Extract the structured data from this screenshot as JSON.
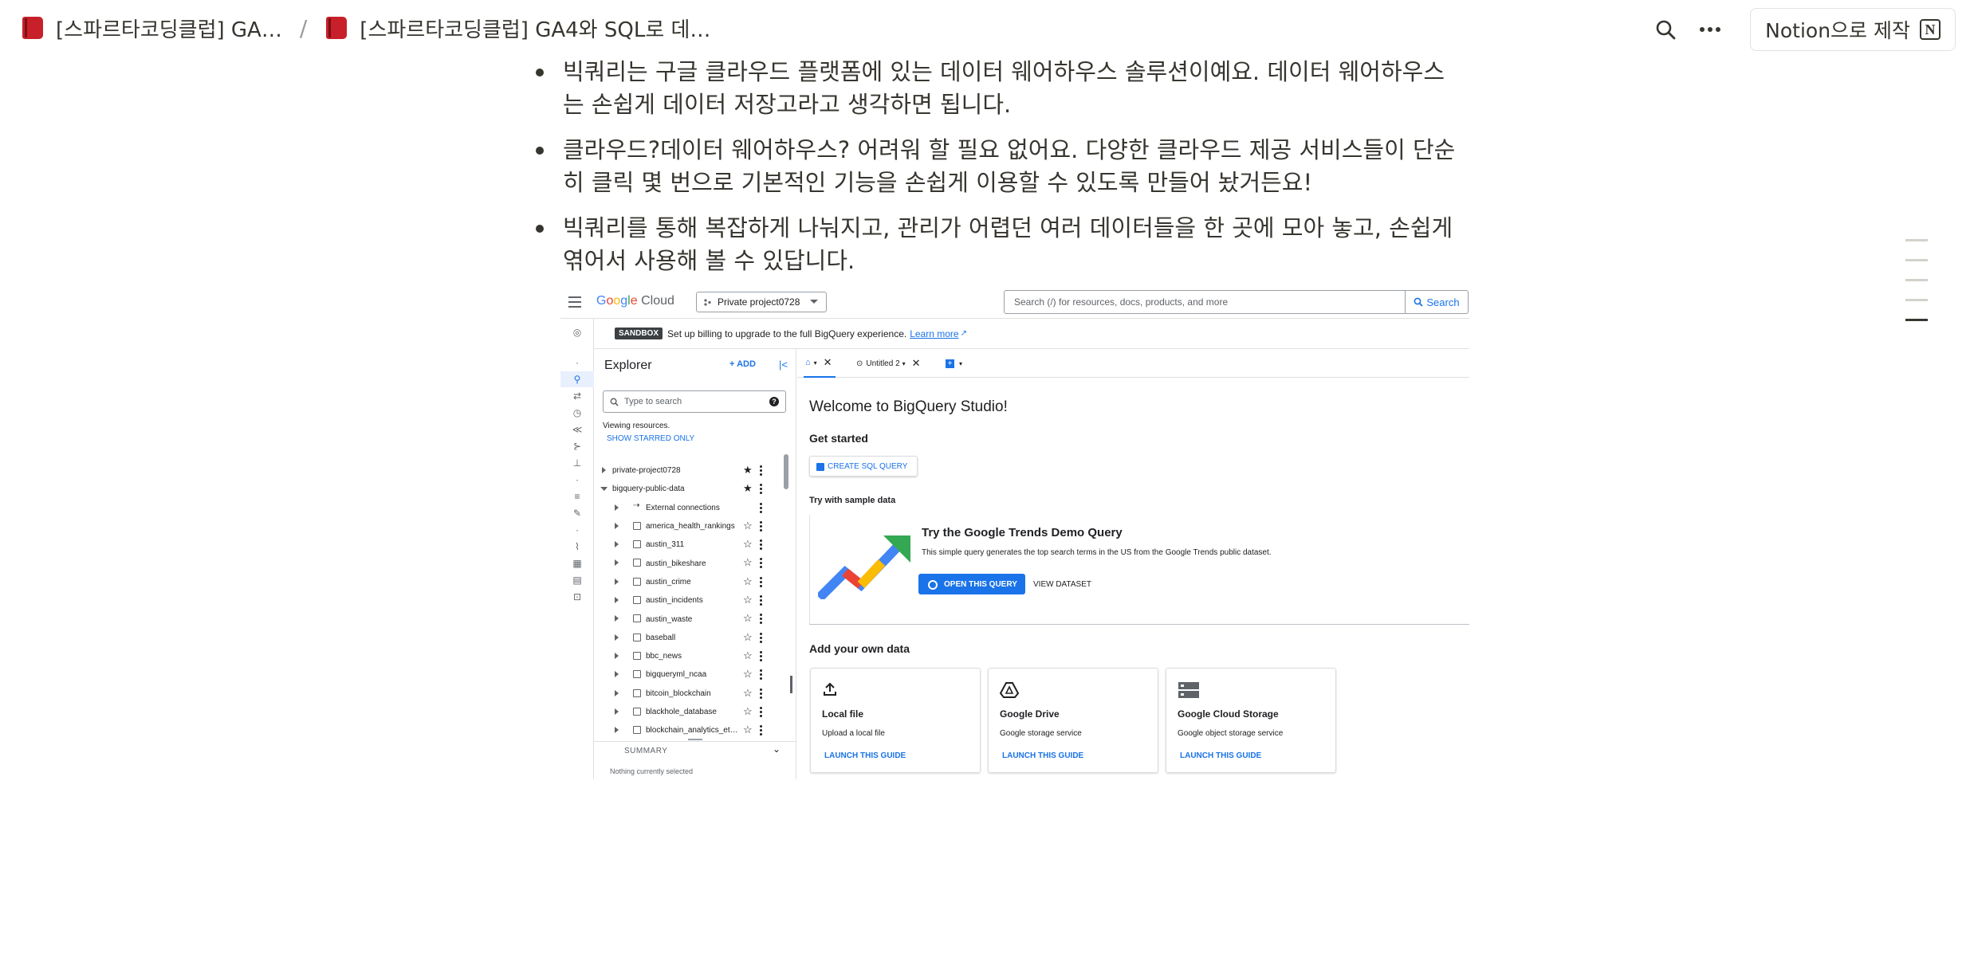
{
  "topbar": {
    "breadcrumbs": [
      "[스파르타코딩클럽] GA…",
      "[스파르타코딩클럽] GA4와 SQL로 데…"
    ],
    "separator": "/",
    "made_with": "Notion으로 제작"
  },
  "content": {
    "bullets": [
      "빅쿼리는 구글 클라우드 플랫폼에 있는 데이터 웨어하우스 솔루션이예요. 데이터 웨어하우스는 손쉽게 데이터 저장고라고 생각하면 됩니다.",
      "클라우드?데이터 웨어하우스? 어려워 할 필요 없어요. 다양한 클라우드 제공 서비스들이 단순히 클릭 몇 번으로 기본적인 기능을 손쉽게 이용할 수 있도록 만들어 놨거든요!",
      "빅쿼리를 통해 복잡하게 나눠지고, 관리가 어렵던 여러 데이터들을 한 곳에 모아 놓고, 손쉽게 엮어서 사용해 볼 수 있답니다."
    ]
  },
  "bigquery": {
    "header": {
      "logo_google": [
        "G",
        "o",
        "o",
        "g",
        "l",
        "e"
      ],
      "logo_cloud": "Cloud",
      "project": "Private project0728",
      "search_placeholder": "Search (/) for resources, docs, products, and more",
      "search_button": "Search"
    },
    "sandbox": {
      "tag": "SANDBOX",
      "message": "Set up billing to upgrade to the full BigQuery experience.",
      "link": "Learn more"
    },
    "explorer": {
      "title": "Explorer",
      "add": "+ ADD",
      "search_placeholder": "Type to search",
      "viewing": "Viewing resources.",
      "show_starred": "SHOW STARRED ONLY",
      "tree": [
        {
          "label": "private-project0728",
          "level": 0,
          "open": false,
          "starred": true
        },
        {
          "label": "bigquery-public-data",
          "level": 0,
          "open": true,
          "starred": true
        },
        {
          "label": "External connections",
          "level": 1,
          "open": false,
          "starred": null
        },
        {
          "label": "america_health_rankings",
          "level": 1,
          "open": false,
          "starred": false
        },
        {
          "label": "austin_311",
          "level": 1,
          "open": false,
          "starred": false
        },
        {
          "label": "austin_bikeshare",
          "level": 1,
          "open": false,
          "starred": false
        },
        {
          "label": "austin_crime",
          "level": 1,
          "open": false,
          "starred": false
        },
        {
          "label": "austin_incidents",
          "level": 1,
          "open": false,
          "starred": false
        },
        {
          "label": "austin_waste",
          "level": 1,
          "open": false,
          "starred": false
        },
        {
          "label": "baseball",
          "level": 1,
          "open": false,
          "starred": false
        },
        {
          "label": "bbc_news",
          "level": 1,
          "open": false,
          "starred": false
        },
        {
          "label": "bigqueryml_ncaa",
          "level": 1,
          "open": false,
          "starred": false
        },
        {
          "label": "bitcoin_blockchain",
          "level": 1,
          "open": false,
          "starred": false
        },
        {
          "label": "blackhole_database",
          "level": 1,
          "open": false,
          "starred": false
        },
        {
          "label": "blockchain_analytics_et…",
          "level": 1,
          "open": false,
          "starred": false
        }
      ],
      "summary_title": "SUMMARY",
      "summary_empty": "Nothing currently selected"
    },
    "tabs": {
      "untitled": "Untitled 2"
    },
    "main": {
      "welcome": "Welcome to BigQuery Studio!",
      "get_started": "Get started",
      "create_sql": "CREATE SQL QUERY",
      "try_sample": "Try with sample data",
      "trends_title": "Try the Google Trends Demo Query",
      "trends_desc": "This simple query generates the top search terms in the US from the Google Trends public dataset.",
      "open_query": "OPEN THIS QUERY",
      "view_dataset": "VIEW DATASET",
      "add_own": "Add your own data",
      "sources": [
        {
          "name": "Local file",
          "desc": "Upload a local file",
          "link": "LAUNCH THIS GUIDE",
          "icon": "upload-icon"
        },
        {
          "name": "Google Drive",
          "desc": "Google storage service",
          "link": "LAUNCH THIS GUIDE",
          "icon": "drive-icon"
        },
        {
          "name": "Google Cloud Storage",
          "desc": "Google object storage service",
          "link": "LAUNCH THIS GUIDE",
          "icon": "storage-icon"
        }
      ]
    }
  },
  "colors": {
    "notion_text": "#37352f",
    "gc_blue": "#1a73e8",
    "book_red": "#c8202a"
  }
}
